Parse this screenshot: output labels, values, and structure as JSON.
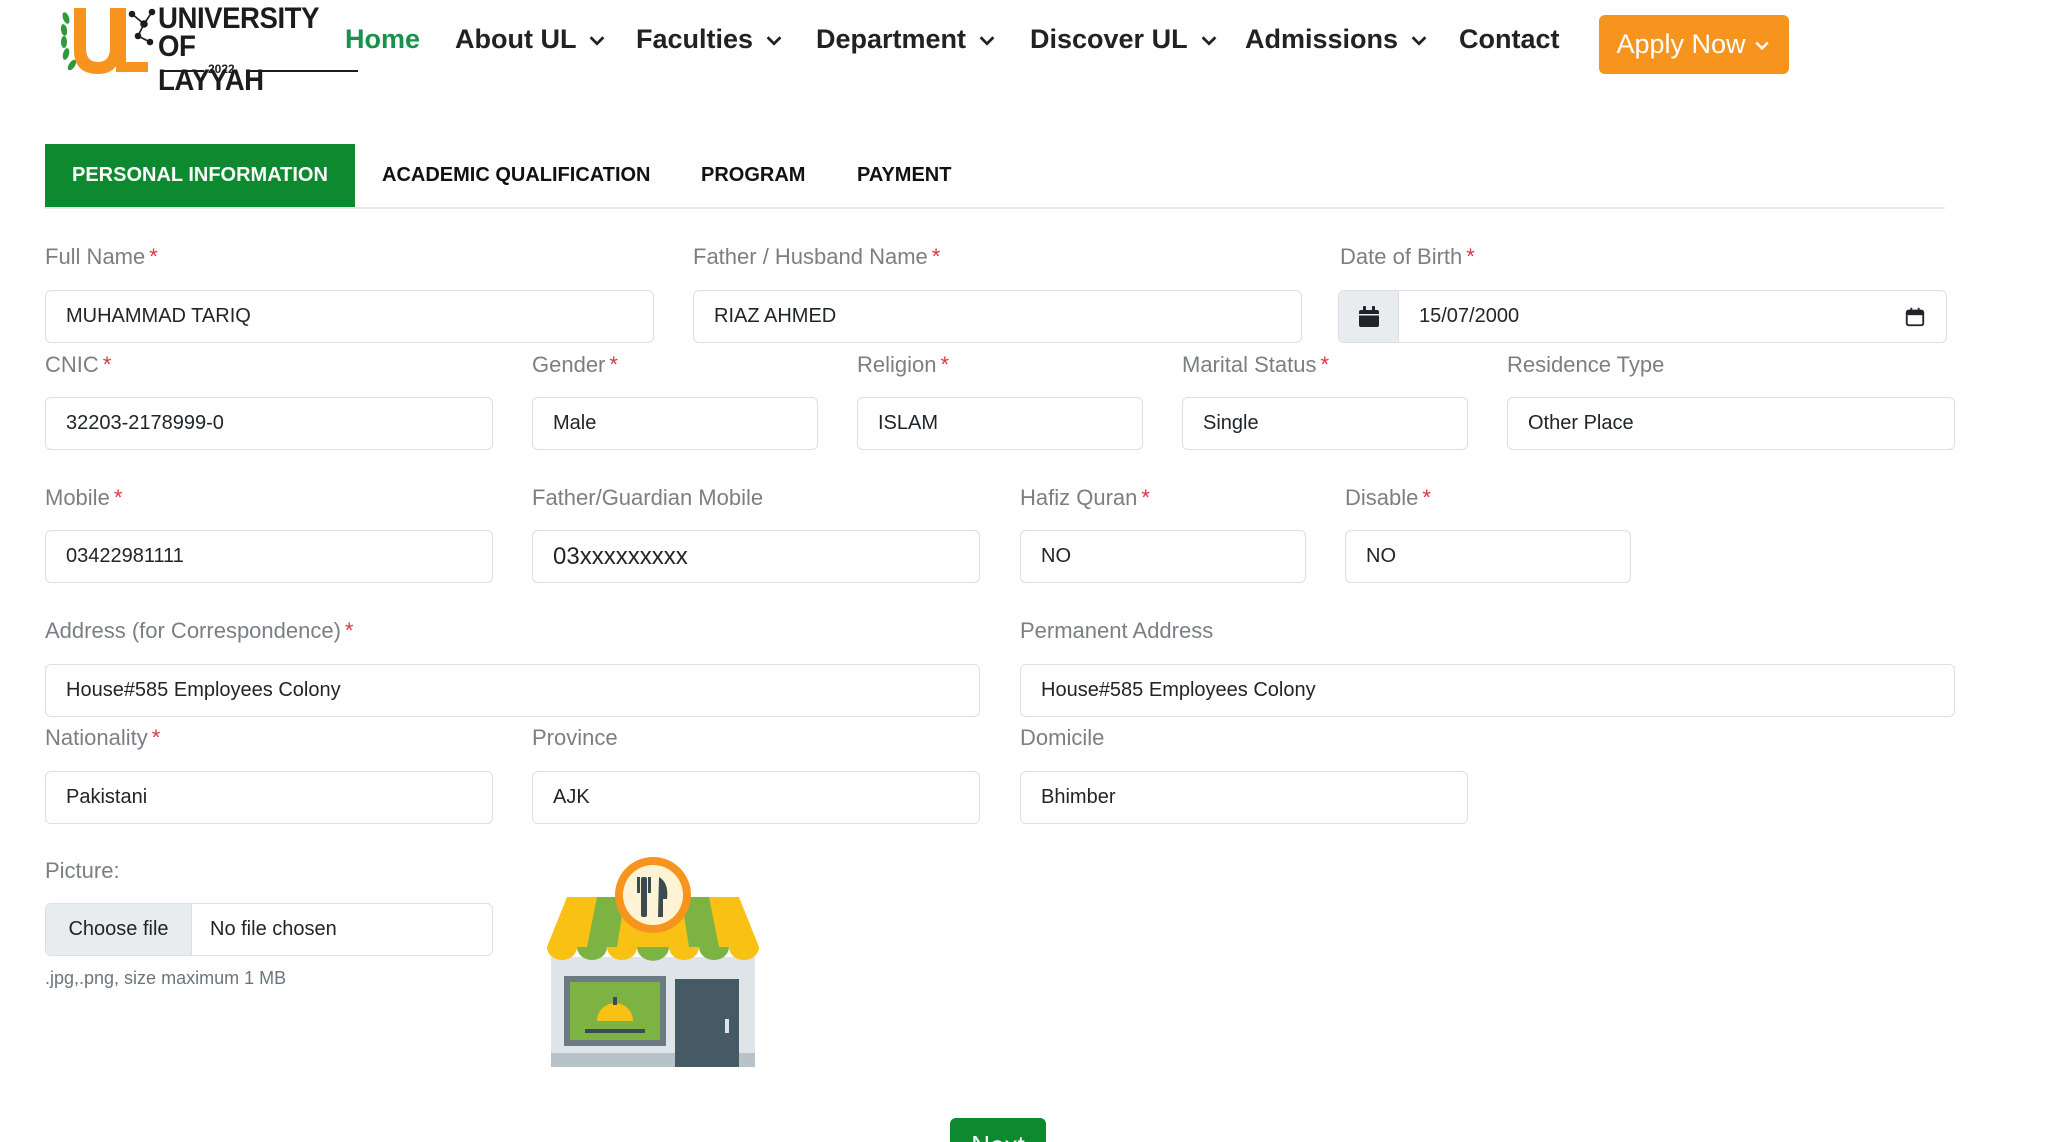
{
  "brand": {
    "line1": "UNIVERSITY",
    "line2": "OF LAYYAH",
    "year": "2022",
    "colors": {
      "green": "#17924a",
      "orange": "#f7941d"
    }
  },
  "nav": {
    "items": [
      {
        "label": "Home",
        "active": true,
        "dropdown": false
      },
      {
        "label": "About UL",
        "dropdown": true
      },
      {
        "label": "Faculties",
        "dropdown": true
      },
      {
        "label": "Department",
        "dropdown": true
      },
      {
        "label": "Discover UL",
        "dropdown": true
      },
      {
        "label": "Admissions",
        "dropdown": true
      },
      {
        "label": "Contact",
        "dropdown": false
      }
    ],
    "apply": {
      "label": "Apply Now",
      "icon": "chevron-down-icon",
      "color": "#f7941d"
    }
  },
  "tabs": [
    {
      "label": "PERSONAL INFORMATION",
      "active": true
    },
    {
      "label": "ACADEMIC QUALIFICATION"
    },
    {
      "label": "PROGRAM"
    },
    {
      "label": "PAYMENT"
    }
  ],
  "form": {
    "full_name": {
      "label": "Full Name",
      "value": "MUHAMMAD TARIQ",
      "required": "*"
    },
    "father_name": {
      "label": "Father / Husband Name",
      "value": "RIAZ AHMED",
      "required": "*"
    },
    "dob": {
      "label": "Date of Birth",
      "value": "15/07/2000",
      "required": "*"
    },
    "cnic": {
      "label": "CNIC",
      "value": "32203-2178999-0",
      "required": "*"
    },
    "gender": {
      "label": "Gender",
      "value": "Male",
      "required": "*"
    },
    "religion": {
      "label": "Religion",
      "value": "ISLAM",
      "required": "*"
    },
    "marital": {
      "label": "Marital Status",
      "value": "Single",
      "required": "*"
    },
    "residence": {
      "label": "Residence Type",
      "value": "Other Place"
    },
    "mobile": {
      "label": "Mobile",
      "value": "03422981111",
      "required": "*"
    },
    "guardian_mobile": {
      "label": "Father/Guardian Mobile",
      "placeholder": "03xxxxxxxxx"
    },
    "hafiz": {
      "label": "Hafiz Quran",
      "value": "NO",
      "required": "*"
    },
    "disable": {
      "label": "Disable",
      "value": "NO",
      "required": "*"
    },
    "address": {
      "label": "Address (for Correspondence)",
      "value": "House#585 Employees Colony",
      "required": "*"
    },
    "permanent_address": {
      "label": "Permanent Address",
      "value": "House#585 Employees Colony"
    },
    "nationality": {
      "label": "Nationality",
      "value": "Pakistani",
      "required": "*"
    },
    "province": {
      "label": "Province",
      "value": "AJK"
    },
    "domicile": {
      "label": "Domicile",
      "value": "Bhimber"
    },
    "picture": {
      "label": "Picture:",
      "button": "Choose file",
      "status": "No file chosen",
      "hint": ".jpg,.png, size maximum 1 MB",
      "preview_icon": "restaurant-store-icon"
    }
  },
  "actions": {
    "next": "Next",
    "color": "#0d8a2f"
  }
}
